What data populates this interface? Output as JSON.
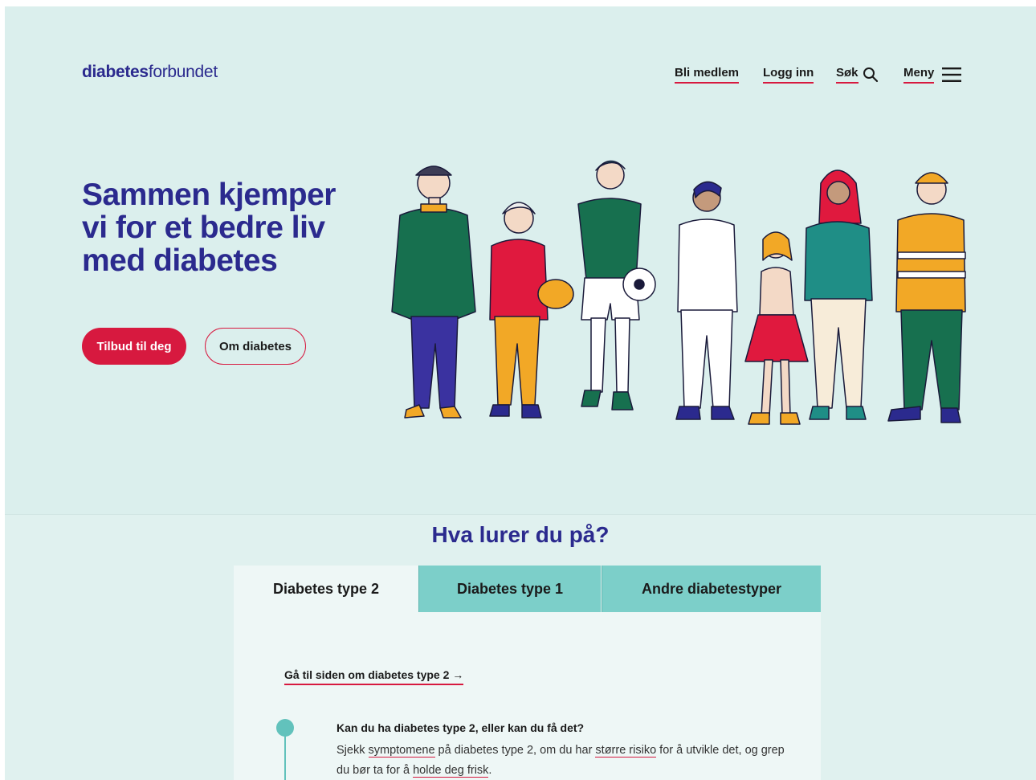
{
  "header": {
    "logo_bold": "diabetes",
    "logo_light": "forbundet",
    "nav": {
      "join": "Bli medlem",
      "login": "Logg inn",
      "search": "Søk",
      "menu": "Meny"
    }
  },
  "hero": {
    "title": "Sammen kjemper vi for et bedre liv med diabetes",
    "primary_button": "Tilbud til deg",
    "secondary_button": "Om diabetes"
  },
  "section": {
    "title": "Hva lurer du på?",
    "tabs": [
      {
        "label": "Diabetes type 2",
        "active": true
      },
      {
        "label": "Diabetes type 1",
        "active": false
      },
      {
        "label": "Andre diabetestyper",
        "active": false
      }
    ],
    "panel": {
      "link": "Gå til siden om diabetes type 2 →",
      "item_title": "Kan du ha diabetes type 2, eller kan du få det?",
      "item_body": {
        "t1": "Sjekk ",
        "link1": "symptomene",
        "t2": " på diabetes type 2, om du har ",
        "link2": "større risiko",
        "t3": " for å utvikle det, og grep du bør ta for å ",
        "link3": "holde deg frisk",
        "t4": "."
      }
    }
  },
  "icons": [
    "search-icon",
    "hamburger-icon"
  ],
  "colors": {
    "brand": "#2b2a8e",
    "accent": "#d7193f",
    "background": "#dbefed",
    "tab": "#7ccfc9",
    "timeline": "#62c2bc"
  }
}
